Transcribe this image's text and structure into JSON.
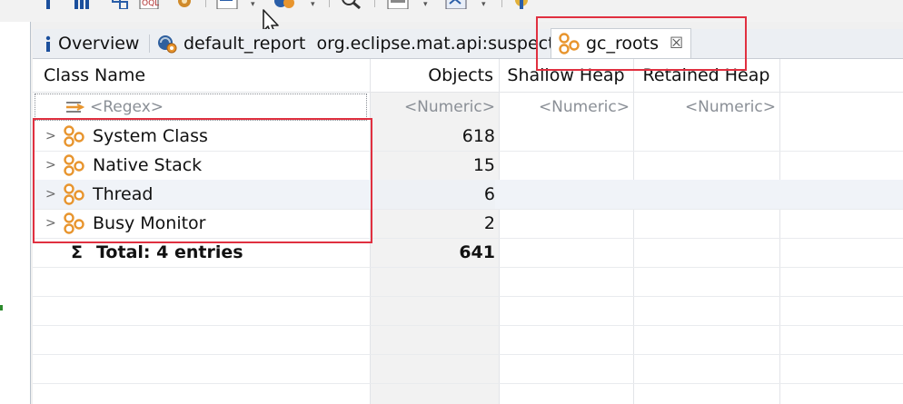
{
  "toolbar": {
    "icons": [
      "info-icon",
      "histogram-icon",
      "dominator-tree-icon",
      "oql-icon",
      "gear-icon",
      "query-browser-icon",
      "report-icon",
      "search-icon",
      "heap-dump-icon",
      "export-icon",
      "gc-icon"
    ]
  },
  "tabs": [
    {
      "label": "Overview",
      "icon": "info-icon",
      "active": false
    },
    {
      "label": "default_report  org.eclipse.mat.api:suspects",
      "icon": "report-icon",
      "active": false
    },
    {
      "label": "gc_roots",
      "icon": "gc-roots-icon",
      "active": true,
      "close": "☒"
    }
  ],
  "table": {
    "columns": [
      "Class Name",
      "Objects",
      "Shallow Heap",
      "Retained Heap"
    ],
    "filters": {
      "class_name": "<Regex>",
      "objects": "<Numeric>",
      "shallow_heap": "<Numeric>",
      "retained_heap": "<Numeric>"
    },
    "rows": [
      {
        "name": "System Class",
        "objects": "618"
      },
      {
        "name": "Native Stack",
        "objects": "15"
      },
      {
        "name": "Thread",
        "objects": "6"
      },
      {
        "name": "Busy Monitor",
        "objects": "2"
      }
    ],
    "total": {
      "label": "Total: 4 entries",
      "objects": "641",
      "symbol": "Σ"
    }
  },
  "colors": {
    "highlight": "#e03040",
    "gc_icon_orange": "#e8952e",
    "row_alt": "#f0f3f8"
  }
}
